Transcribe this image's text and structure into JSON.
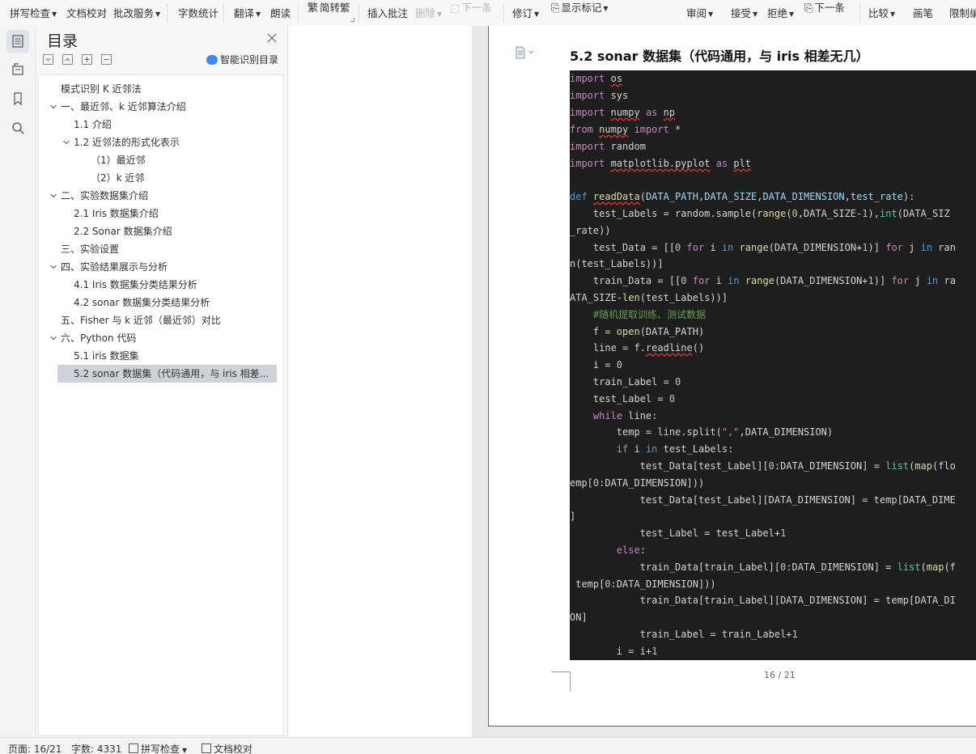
{
  "toolbar": {
    "spell_check": "拼写检查",
    "doc_proofread": "文档校对",
    "batch_service": "批改服务",
    "word_count": "字数统计",
    "translate": "翻译",
    "read_aloud": "朗读",
    "simp_trad": "简转繁",
    "insert_comment": "插入批注",
    "delete": "删除",
    "next": "下一条",
    "revise": "修订",
    "show_marks": "显示标记",
    "review": "审阅",
    "accept": "接受",
    "reject": "拒绝",
    "next2": "下一条",
    "compare": "比较",
    "ink": "画笔",
    "restrict": "限制编"
  },
  "toc": {
    "title": "目录",
    "smart_toc": "智能识别目录",
    "items": [
      {
        "label": "模式识别  K 近邻法"
      },
      {
        "label": "一、最近邻、k 近邻算法介绍"
      },
      {
        "label": "1.1  介绍"
      },
      {
        "label": "1.2  近邻法的形式化表示"
      },
      {
        "label": "（1）最近邻"
      },
      {
        "label": "（2）k 近邻"
      },
      {
        "label": "二、实验数据集介绍"
      },
      {
        "label": "2.1 Iris 数据集介绍"
      },
      {
        "label": "2.2 Sonar 数据集介绍"
      },
      {
        "label": "三、实验设置"
      },
      {
        "label": "四、实验结果展示与分析"
      },
      {
        "label": "4.1 Iris 数据集分类结果分析"
      },
      {
        "label": "4.2 sonar 数据集分类结果分析"
      },
      {
        "label": "五、Fisher 与 k 近邻（最近邻）对比"
      },
      {
        "label": "六、Python 代码"
      },
      {
        "label": "5.1 iris 数据集"
      },
      {
        "label": "5.2 sonar 数据集（代码通用，与 iris 相差..."
      }
    ]
  },
  "document": {
    "heading": "5.2 sonar 数据集（代码通用，与 iris 相差无几）",
    "page_number": "16 / 21",
    "code_lines": [
      "import os",
      "import sys",
      "import numpy as np",
      "from numpy import *",
      "import random",
      "import matplotlib.pyplot as plt",
      "",
      "def readData(DATA_PATH,DATA_SIZE,DATA_DIMENSION,test_rate):",
      "    test_Labels = random.sample(range(0,DATA_SIZE-1),int(DATA_SIZ",
      "_rate))",
      "    test_Data = [[0 for i in range(DATA_DIMENSION+1)] for j in ran",
      "n(test_Labels))]",
      "    train_Data = [[0 for i in range(DATA_DIMENSION+1)] for j in ra",
      "ATA_SIZE-len(test_Labels))]",
      "    #随机提取训练、测试数据",
      "    f = open(DATA_PATH)",
      "    line = f.readline()",
      "    i = 0",
      "    train_Label = 0",
      "    test_Label = 0",
      "    while line:",
      "        temp = line.split(\",\",DATA_DIMENSION)",
      "        if i in test_Labels:",
      "            test_Data[test_Label][0:DATA_DIMENSION] = list(map(flo",
      "emp[0:DATA_DIMENSION]))",
      "            test_Data[test_Label][DATA_DIMENSION] = temp[DATA_DIME",
      "]",
      "            test_Label = test_Label+1",
      "        else:",
      "            train_Data[train_Label][0:DATA_DIMENSION] = list(map(f",
      " temp[0:DATA_DIMENSION]))",
      "            train_Data[train_Label][DATA_DIMENSION] = temp[DATA_DI",
      "ON]",
      "            train_Label = train_Label+1",
      "        i = i+1"
    ]
  },
  "status": {
    "page": "页面: 16/21",
    "words": "字数: 4331",
    "spell_check": "拼写检查",
    "proofread": "文档校对"
  }
}
